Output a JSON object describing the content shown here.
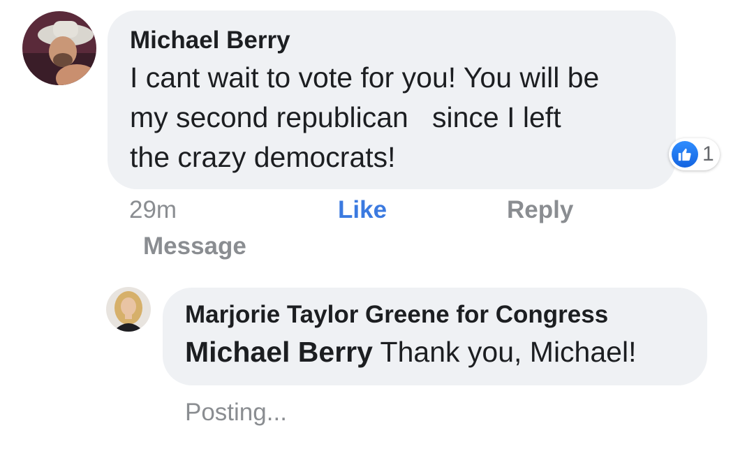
{
  "comment": {
    "author": "Michael Berry",
    "text": "I cant wait to vote for you! You will be\nmy second republican   since I left\nthe crazy democrats!",
    "time": "29m",
    "reaction_count": "1",
    "reaction_icon": "thumbs-up-icon",
    "actions": {
      "like": "Like",
      "reply": "Reply",
      "message": "Message"
    }
  },
  "reply": {
    "author": "Marjorie Taylor Greene for Congress",
    "tag": "Michael Berry",
    "text": " Thank you, Michael!",
    "status": "Posting..."
  },
  "colors": {
    "bubble": "#eff1f4",
    "like_link": "#3b7ae0",
    "muted_text": "#8a8d91",
    "like_badge": "#1877f2"
  }
}
